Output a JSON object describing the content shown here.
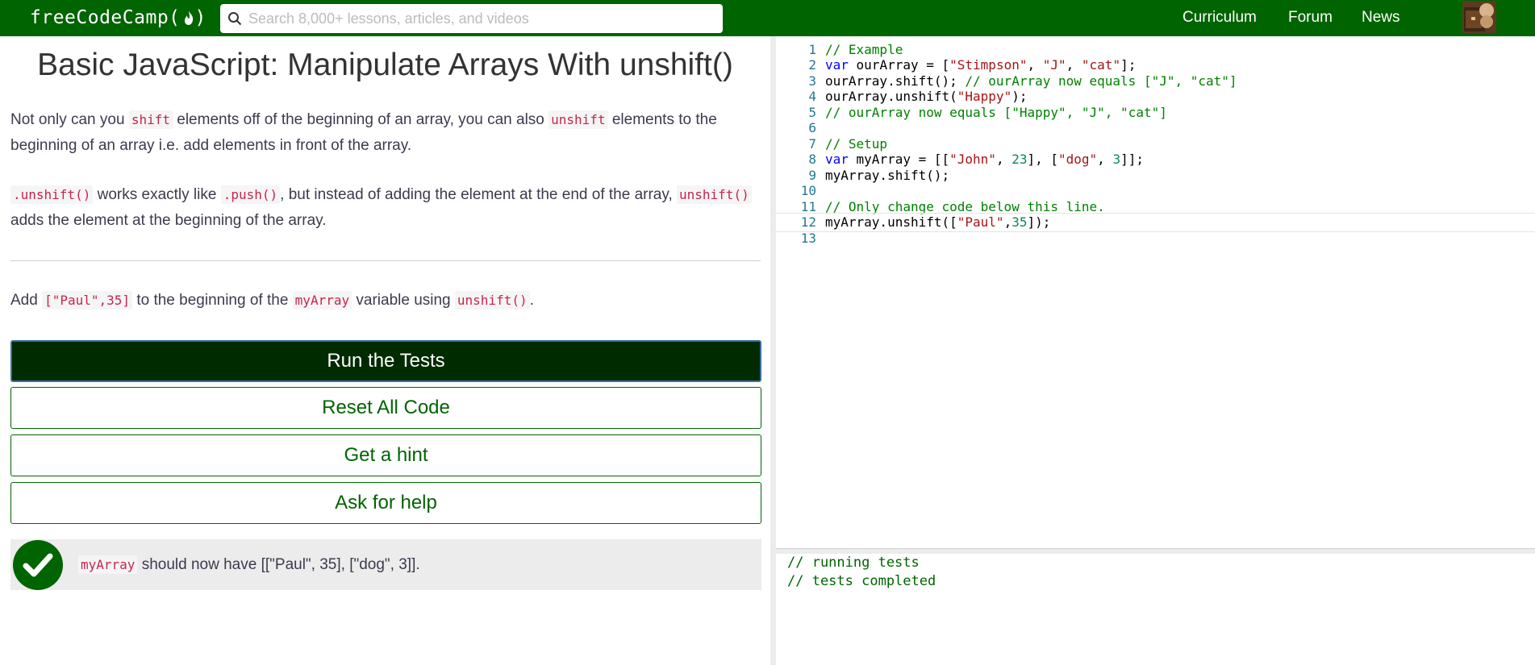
{
  "nav": {
    "logo_text": "freeCodeCamp(",
    "logo_close": ")",
    "search_placeholder": "Search 8,000+ lessons, articles, and videos",
    "links": [
      "Curriculum",
      "Forum",
      "News"
    ],
    "colors": {
      "bar": "#006400",
      "text": "#ffffff"
    }
  },
  "challenge": {
    "title": "Basic JavaScript: Manipulate Arrays With unshift()",
    "p1": {
      "t1": "Not only can you ",
      "c1": "shift",
      "t2": " elements off of the beginning of an array, you can also ",
      "c2": "unshift",
      "t3": " elements to the beginning of an array i.e. add elements in front of the array."
    },
    "p2": {
      "c1": ".unshift()",
      "t1": " works exactly like ",
      "c2": ".push()",
      "t2": ", but instead of adding the element at the end of the array, ",
      "c3": "unshift()",
      "t3": " adds the element at the beginning of the array."
    },
    "p3": {
      "t1": "Add ",
      "c1": "[\"Paul\",35]",
      "t2": " to the beginning of the ",
      "c2": "myArray",
      "t3": " variable using ",
      "c3": "unshift()",
      "t4": "."
    }
  },
  "buttons": {
    "run": "Run the Tests",
    "reset": "Reset All Code",
    "hint": "Get a hint",
    "help": "Ask for help"
  },
  "test": {
    "status": "passed",
    "code": "myArray",
    "text": " should now have [[\"Paul\", 35], [\"dog\", 3]]."
  },
  "editor": {
    "active_line": 12,
    "lines": [
      {
        "n": "1",
        "segs": [
          {
            "t": "// Example",
            "c": "cm"
          }
        ]
      },
      {
        "n": "2",
        "segs": [
          {
            "t": "var",
            "c": "kw"
          },
          {
            "t": " ourArray = [",
            "c": ""
          },
          {
            "t": "\"Stimpson\"",
            "c": "str"
          },
          {
            "t": ", ",
            "c": ""
          },
          {
            "t": "\"J\"",
            "c": "str"
          },
          {
            "t": ", ",
            "c": ""
          },
          {
            "t": "\"cat\"",
            "c": "str"
          },
          {
            "t": "];",
            "c": ""
          }
        ]
      },
      {
        "n": "3",
        "segs": [
          {
            "t": "ourArray.shift(); ",
            "c": ""
          },
          {
            "t": "// ourArray now equals [\"J\", \"cat\"]",
            "c": "cm"
          }
        ]
      },
      {
        "n": "4",
        "segs": [
          {
            "t": "ourArray.unshift(",
            "c": ""
          },
          {
            "t": "\"Happy\"",
            "c": "str"
          },
          {
            "t": ");",
            "c": ""
          }
        ]
      },
      {
        "n": "5",
        "segs": [
          {
            "t": "// ourArray now equals [\"Happy\", \"J\", \"cat\"]",
            "c": "cm"
          }
        ]
      },
      {
        "n": "6",
        "segs": []
      },
      {
        "n": "7",
        "segs": [
          {
            "t": "// Setup",
            "c": "cm"
          }
        ]
      },
      {
        "n": "8",
        "segs": [
          {
            "t": "var",
            "c": "kw"
          },
          {
            "t": " myArray = [[",
            "c": ""
          },
          {
            "t": "\"John\"",
            "c": "str"
          },
          {
            "t": ", ",
            "c": ""
          },
          {
            "t": "23",
            "c": "num"
          },
          {
            "t": "], [",
            "c": ""
          },
          {
            "t": "\"dog\"",
            "c": "str"
          },
          {
            "t": ", ",
            "c": ""
          },
          {
            "t": "3",
            "c": "num"
          },
          {
            "t": "]];",
            "c": ""
          }
        ]
      },
      {
        "n": "9",
        "segs": [
          {
            "t": "myArray.shift();",
            "c": ""
          }
        ]
      },
      {
        "n": "10",
        "segs": []
      },
      {
        "n": "11",
        "segs": [
          {
            "t": "// Only change code below this line.",
            "c": "cm"
          }
        ]
      },
      {
        "n": "12",
        "segs": [
          {
            "t": "myArray.unshift([",
            "c": ""
          },
          {
            "t": "\"Paul\"",
            "c": "str"
          },
          {
            "t": ",",
            "c": ""
          },
          {
            "t": "35",
            "c": "num"
          },
          {
            "t": "]);",
            "c": ""
          }
        ]
      },
      {
        "n": "13",
        "segs": []
      }
    ]
  },
  "console": {
    "lines": [
      "// running tests",
      "// tests completed"
    ]
  }
}
